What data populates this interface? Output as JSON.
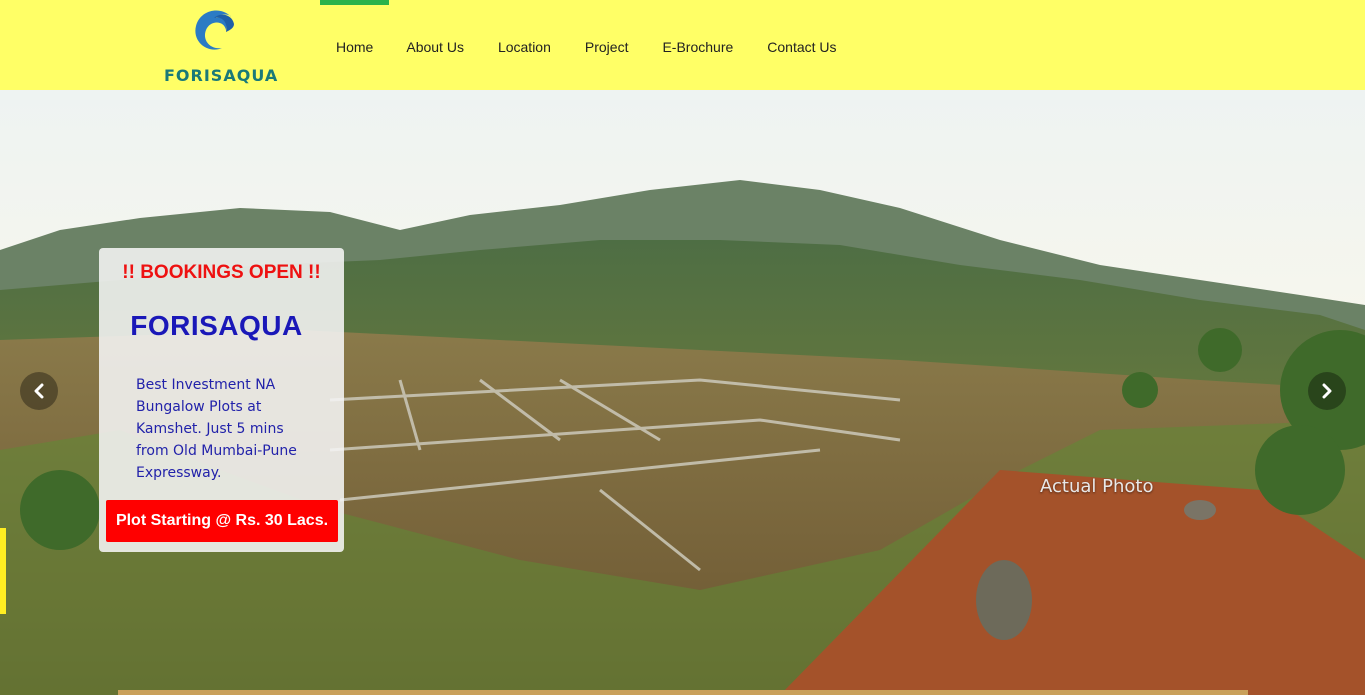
{
  "brand": {
    "name": "FORISAQUA",
    "logo_icon": "wave-swirl-icon",
    "color": "#1a7a78"
  },
  "nav": {
    "items": [
      {
        "label": "Home",
        "active": true
      },
      {
        "label": "About Us",
        "active": false
      },
      {
        "label": "Location",
        "active": false
      },
      {
        "label": "Project",
        "active": false
      },
      {
        "label": "E-Brochure",
        "active": false
      },
      {
        "label": "Contact Us",
        "active": false
      }
    ],
    "active_color": "#2bb34b"
  },
  "header": {
    "background": "#ffff66"
  },
  "hero": {
    "photo_caption": "Actual Photo",
    "promo": {
      "heading": "!! BOOKINGS OPEN !!",
      "title": "FORISAQUA",
      "description": "Best Investment NA Bungalow Plots at Kamshet. Just 5 mins from Old Mumbai-Pune Expressway.",
      "cta_label": "Plot Starting @ Rs. 30 Lacs."
    },
    "prev_icon": "chevron-left-icon",
    "next_icon": "chevron-right-icon",
    "colors": {
      "heading": "#ee1111",
      "title": "#1a18b8",
      "cta": "#ff0000"
    }
  }
}
